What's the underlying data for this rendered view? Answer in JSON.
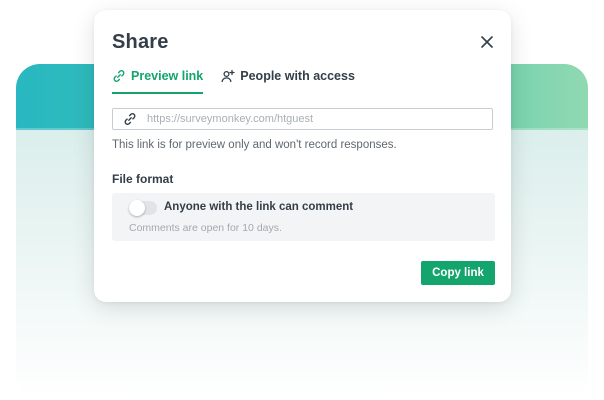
{
  "dialog": {
    "title": "Share",
    "close_icon": "close-icon"
  },
  "tabs": [
    {
      "label": "Preview link",
      "icon": "link-icon",
      "active": true
    },
    {
      "label": "People with access",
      "icon": "add-person-icon",
      "active": false
    }
  ],
  "url_field": {
    "placeholder": "https://surveymonkey.com/htguest",
    "value": "",
    "icon": "link-icon"
  },
  "helper_text": "This link is for preview only and won't record responses.",
  "file_format": {
    "title": "File format",
    "toggle_label": "Anyone with the link can comment",
    "toggle_on": false,
    "subtext": "Comments are open for 10 days."
  },
  "copy_button": {
    "label": "Copy link"
  },
  "colors": {
    "accent": "#14a46d",
    "band_start": "#29b8c1",
    "band_end": "#90d9b2",
    "text_primary": "#333e48"
  }
}
